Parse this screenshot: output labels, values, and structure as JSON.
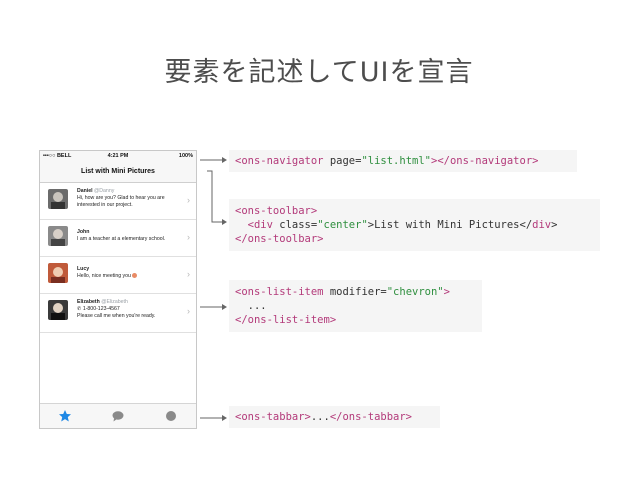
{
  "slide": {
    "title": "要素を記述してUIを宣言"
  },
  "phone": {
    "status": {
      "carrier": "•••○○ BELL",
      "time": "4:21 PM",
      "battery": "100%"
    },
    "toolbar_title": "List with Mini Pictures",
    "items": [
      {
        "name": "Daniel",
        "handle": "@Danny",
        "message": "Hi, how are you? Glad to hear you are interested in our project."
      },
      {
        "name": "John",
        "handle": "",
        "message": "I am a teacher at a elementary school."
      },
      {
        "name": "Lucy",
        "handle": "",
        "message": "Hello, nice meeting you"
      },
      {
        "name": "Elizabeth",
        "handle": "@Elizabeth",
        "phone": "1-800-123-4567",
        "message": "Please call me when you're ready."
      }
    ],
    "chevron": "›",
    "tabs": [
      "star-icon",
      "chat-bubble-icon",
      "circle-icon"
    ]
  },
  "code_blocks": {
    "navigator": {
      "open_tag": "<ons-navigator",
      "attr": " page=",
      "value": "\"list.html\"",
      "close": "></ons-navigator>"
    },
    "toolbar": {
      "line1": "<ons-toolbar>",
      "line2_open": "  <div",
      "line2_attr": " class=",
      "line2_value": "\"center\"",
      "line2_text": ">List with Mini Pictures</",
      "line2_tag": "div",
      "line2_end": ">",
      "line3": "</ons-toolbar>"
    },
    "list_item": {
      "line1_open": "<ons-list-item",
      "line1_attr": " modifier=",
      "line1_value": "\"chevron\"",
      "line1_end": ">",
      "line2": "  ...",
      "line3": "</ons-list-item>"
    },
    "tabbar": {
      "open": "<ons-tabbar>",
      "dots": "...",
      "close": "</ons-tabbar>"
    }
  }
}
